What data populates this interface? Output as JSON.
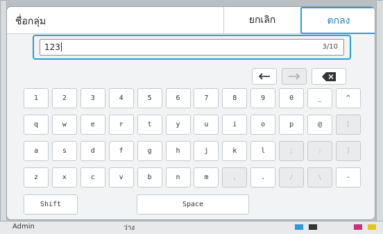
{
  "dialog": {
    "title": "ชื่อกลุ่ม",
    "cancel_label": "ยกเลิก",
    "ok_label": "ตกลง"
  },
  "input": {
    "value": "123",
    "counter": "3/10"
  },
  "nav": {
    "left": "left-arrow-icon",
    "right": "right-arrow-icon",
    "backspace": "backspace-icon"
  },
  "keyboard": {
    "row1": [
      "1",
      "2",
      "3",
      "4",
      "5",
      "6",
      "7",
      "8",
      "9",
      "0",
      "_",
      "^"
    ],
    "row2": [
      "q",
      "w",
      "e",
      "r",
      "t",
      "y",
      "u",
      "i",
      "o",
      "p",
      "@",
      "["
    ],
    "row3": [
      "a",
      "s",
      "d",
      "f",
      "g",
      "h",
      "j",
      "k",
      "l",
      ";",
      ":",
      "]"
    ],
    "row4": [
      "z",
      "x",
      "c",
      "v",
      "b",
      "n",
      "m",
      ",",
      ".",
      "/",
      "\\",
      "-"
    ],
    "shift_label": "Shift",
    "space_label": "Space"
  },
  "status_bar": {
    "user": "Admin",
    "mid_text": "ว่าง"
  },
  "colors": {
    "accent": "#2e9ad6",
    "ok_text": "#1b7fc4"
  }
}
